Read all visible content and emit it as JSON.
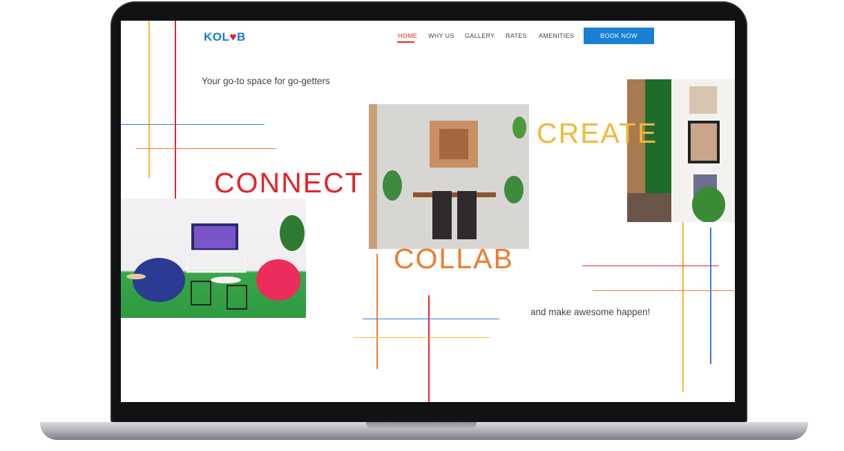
{
  "brand": {
    "logo_prefix": "KOL",
    "logo_heart": "♥",
    "logo_suffix": "B"
  },
  "nav": {
    "items": [
      {
        "label": "HOME",
        "active": true
      },
      {
        "label": "WHY US",
        "active": false
      },
      {
        "label": "GALLERY",
        "active": false
      },
      {
        "label": "RATES",
        "active": false
      },
      {
        "label": "AMENITIES",
        "active": false
      }
    ],
    "cta": "BOOK NOW"
  },
  "hero": {
    "tagline": "Your go-to space for go-getters",
    "closing": "and make awesome happen!",
    "words": {
      "connect": "CONNECT",
      "create": "CREATE",
      "collab": "COLLAB"
    }
  },
  "photos": {
    "lounge": "lounge-photo",
    "dining": "dining-photo",
    "wall": "green-wall-photo"
  },
  "colors": {
    "brand_blue": "#1a78d1",
    "red": "#e4232a",
    "orange": "#ef7b2e",
    "yellow": "#f0b83b",
    "blue_line": "#2f7fd3"
  }
}
